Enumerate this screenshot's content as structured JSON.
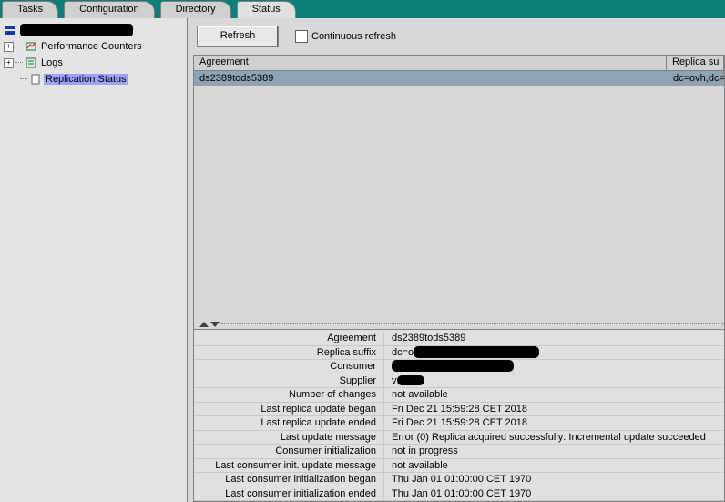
{
  "tabs": [
    "Tasks",
    "Configuration",
    "Directory",
    "Status"
  ],
  "tree": {
    "perf": "Performance Counters",
    "logs": "Logs",
    "replication": "Replication Status"
  },
  "toolbar": {
    "refresh": "Refresh",
    "continuous": "Continuous refresh"
  },
  "list": {
    "hdr": [
      "Agreement",
      "Replica su"
    ],
    "rows": [
      {
        "agreement": "ds2389tods5389",
        "replica": "dc=ovh,dc="
      }
    ]
  },
  "detail": {
    "labels": {
      "agreement": "Agreement",
      "replica_suffix": "Replica suffix",
      "consumer": "Consumer",
      "supplier": "Supplier",
      "nchanges": "Number of changes",
      "last_upd_began": "Last replica update began",
      "last_upd_ended": "Last replica update ended",
      "last_upd_msg": "Last update message",
      "cons_init": "Consumer initialization",
      "lci_upd_msg": "Last consumer init. update message",
      "lci_began": "Last consumer initialization began",
      "lci_ended": "Last consumer initialization ended"
    },
    "values": {
      "agreement": "ds2389tods5389",
      "replica_suffix_pre": "dc=o",
      "supplier_pre": "v",
      "nchanges": "not available",
      "last_upd_began": "Fri Dec 21 15:59:28 CET 2018",
      "last_upd_ended": "Fri Dec 21 15:59:28 CET 2018",
      "last_upd_msg": "Error (0) Replica acquired successfully: Incremental update succeeded",
      "cons_init": "not in progress",
      "lci_upd_msg": "not available",
      "lci_began": "Thu Jan 01 01:00:00 CET 1970",
      "lci_ended": "Thu Jan 01 01:00:00 CET 1970"
    }
  }
}
